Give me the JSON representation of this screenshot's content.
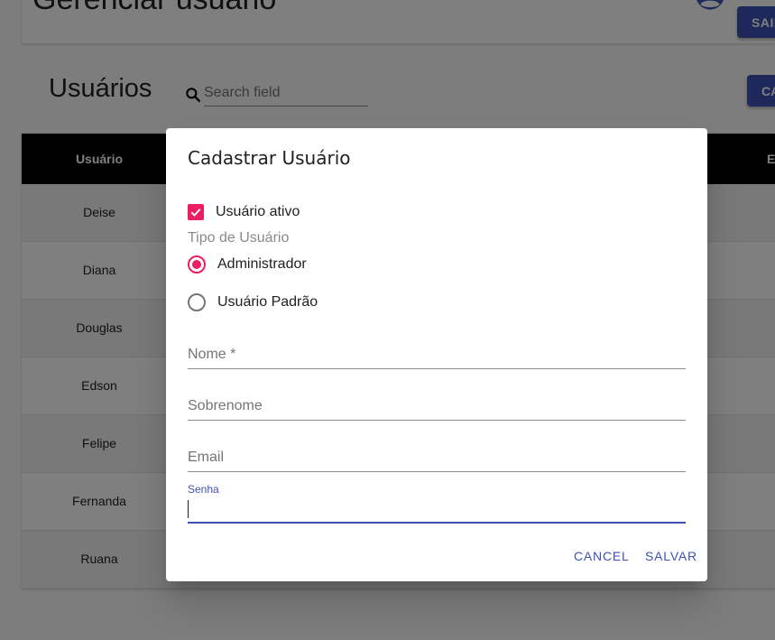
{
  "header": {
    "title": "Gerenciar usuário",
    "logout_label": "SAIR"
  },
  "users": {
    "title": "Usuários",
    "search_placeholder": "Search field",
    "create_label": "CADASTRAR"
  },
  "table": {
    "columns": [
      "Usuário",
      "E"
    ],
    "rows": [
      "Deise",
      "Diana",
      "Douglas",
      "Edson",
      "Felipe",
      "Fernanda",
      "Ruana"
    ]
  },
  "dialog": {
    "title": "Cadastrar Usuário",
    "active_checkbox_label": "Usuário ativo",
    "active_checked": true,
    "user_type_label": "Tipo de Usuário",
    "user_type_options": [
      "Administrador",
      "Usuário Padrão"
    ],
    "user_type_selected": "Administrador",
    "fields": {
      "nome": "Nome *",
      "sobrenome": "Sobrenome",
      "email": "Email",
      "senha": "Senha"
    },
    "cancel_label": "CANCEL",
    "save_label": "SALVAR"
  },
  "colors": {
    "primary": "#3f51b5",
    "accent": "#e91e63",
    "table_header": "#000000"
  }
}
